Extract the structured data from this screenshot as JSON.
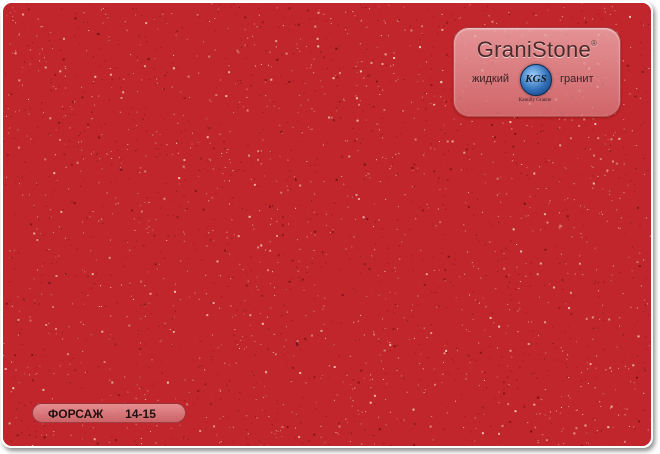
{
  "logo": {
    "brand": "GraniStone",
    "registered": "®",
    "tagline_left": "жидкий",
    "tagline_right": "гранит",
    "emblem_letters": "KGS",
    "emblem_caption": "Kamilly Granite"
  },
  "sample": {
    "name": "ФОРСАЖ",
    "code": "14-15"
  },
  "colors": {
    "base": "#c0262b",
    "speckle_light": "#f2d6c2",
    "speckle_dark": "#6e1013"
  }
}
